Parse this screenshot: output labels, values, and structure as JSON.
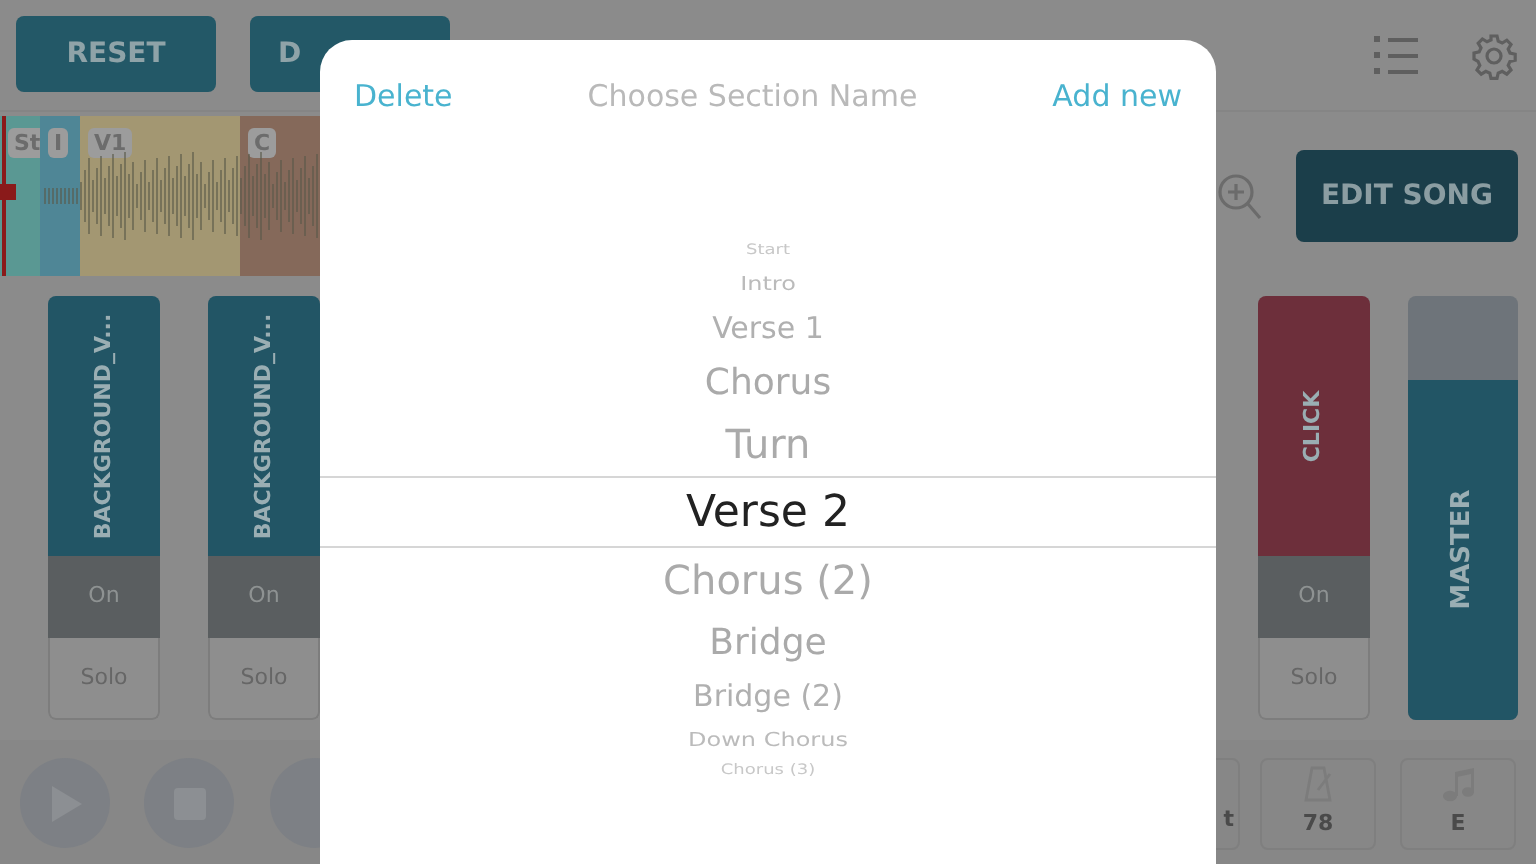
{
  "toolbar": {
    "buttons": [
      {
        "label": "RESET"
      },
      {
        "label": "D"
      }
    ]
  },
  "timeline": {
    "sections": [
      {
        "label": "St",
        "color": "#5a9893"
      },
      {
        "label": "I",
        "color": "#4f8696"
      },
      {
        "label": "V1",
        "color": "#a39772"
      },
      {
        "label": "C",
        "color": "#85695a"
      }
    ]
  },
  "edit_button": {
    "label": "EDIT SONG"
  },
  "channels": [
    {
      "name": "BACKGROUND_V...",
      "color": "#225565",
      "on_label": "On",
      "on": true,
      "solo_label": "Solo",
      "solo": false
    },
    {
      "name": "BACKGROUND_V...",
      "color": "#225565",
      "on_label": "On",
      "on": true,
      "solo_label": "Solo",
      "solo": false
    },
    {
      "name": "CLICK",
      "color": "#6d2f3b",
      "on_label": "On",
      "on": true,
      "solo_label": "Solo",
      "solo": false
    }
  ],
  "master": {
    "name": "MASTER",
    "level": 0.8
  },
  "bottom_bar": {
    "partial_button": "t",
    "tempo": "78",
    "key": "E"
  },
  "picker": {
    "delete": "Delete",
    "title": "Choose Section Name",
    "add": "Add new",
    "items": [
      {
        "label": "Start",
        "selected": false
      },
      {
        "label": "Intro",
        "selected": false
      },
      {
        "label": "Verse 1",
        "selected": false
      },
      {
        "label": "Chorus",
        "selected": false
      },
      {
        "label": "Turn",
        "selected": false
      },
      {
        "label": "Verse 2",
        "selected": true
      },
      {
        "label": "Chorus (2)",
        "selected": false
      },
      {
        "label": "Bridge",
        "selected": false
      },
      {
        "label": "Bridge (2)",
        "selected": false
      },
      {
        "label": "Down Chorus",
        "selected": false
      },
      {
        "label": "Chorus (3)",
        "selected": false
      }
    ]
  }
}
